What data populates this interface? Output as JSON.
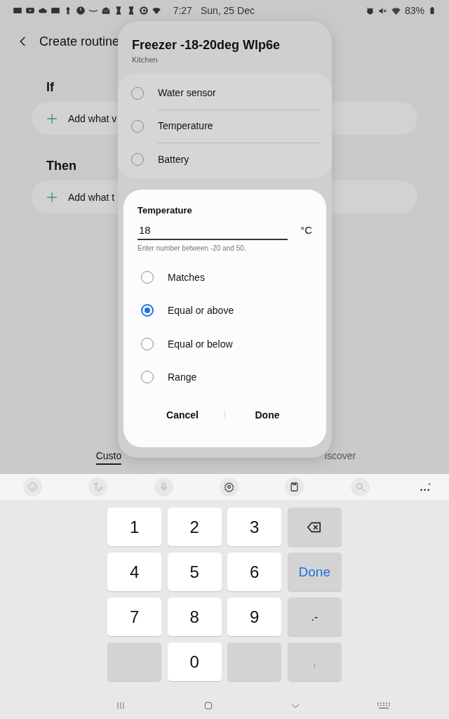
{
  "status_bar": {
    "time": "7:27",
    "date": "Sun, 25 Dec",
    "battery": "83%"
  },
  "header": {
    "title": "Create routine"
  },
  "sections": [
    {
      "heading": "If",
      "action": "Add what v"
    },
    {
      "heading": "Then",
      "action": "Add what t"
    }
  ],
  "tabs": [
    {
      "label": "Custo",
      "selected": true
    },
    {
      "label": "iscover",
      "selected": false
    }
  ],
  "device_sheet": {
    "title": "Freezer -18-20deg Wlp6e",
    "room": "Kitchen",
    "capabilities": [
      {
        "label": "Water sensor",
        "selected": false
      },
      {
        "label": "Temperature",
        "selected": false
      },
      {
        "label": "Battery",
        "selected": false
      }
    ]
  },
  "dialog": {
    "title": "Temperature",
    "field": {
      "value": "18",
      "unit": "°C",
      "hint": "Enter number between -20 and 50."
    },
    "options": [
      {
        "label": "Matches",
        "selected": false
      },
      {
        "label": "Equal or above",
        "selected": true
      },
      {
        "label": "Equal or below",
        "selected": false
      },
      {
        "label": "Range",
        "selected": false
      }
    ],
    "buttons": [
      "Cancel",
      "Done"
    ]
  },
  "keyboard": {
    "keys": [
      {
        "kind": "digit",
        "label": "1"
      },
      {
        "kind": "digit",
        "label": "2"
      },
      {
        "kind": "digit",
        "label": "3"
      },
      {
        "kind": "backspace"
      },
      {
        "kind": "digit",
        "label": "4"
      },
      {
        "kind": "digit",
        "label": "5"
      },
      {
        "kind": "digit",
        "label": "6"
      },
      {
        "kind": "done",
        "label": "Done"
      },
      {
        "kind": "digit",
        "label": "7"
      },
      {
        "kind": "digit",
        "label": "8"
      },
      {
        "kind": "digit",
        "label": "9"
      },
      {
        "kind": "symbol",
        "label": ".-"
      },
      {
        "kind": "blank"
      },
      {
        "kind": "digit",
        "label": "0"
      },
      {
        "kind": "blank"
      },
      {
        "kind": "disabled",
        "label": ","
      }
    ]
  }
}
